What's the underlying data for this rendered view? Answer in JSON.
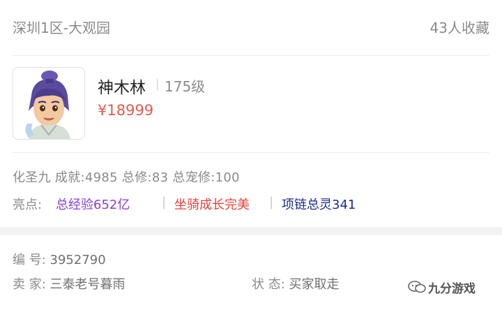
{
  "header": {
    "server": "深圳1区-大观园",
    "favorites": "43人收藏"
  },
  "role": {
    "name": "神木林",
    "level": "175级",
    "price": "¥18999"
  },
  "stats": "化圣九 成就:4985 总修:83 总宠修:100",
  "highlights": {
    "label": "亮点:",
    "items": [
      {
        "text": "总经验652亿",
        "color": "#8a3fd1"
      },
      {
        "text": "坐骑成长完美",
        "color": "#e0433a"
      },
      {
        "text": "项链总灵341",
        "color": "#1c2a8c"
      }
    ],
    "separator": "|"
  },
  "details": {
    "id_label": "编 号:",
    "id_value": "3952790",
    "seller_label": "卖 家:",
    "seller_value": "三泰老号暮雨",
    "status_label": "状 态:",
    "status_value": "买家取走"
  },
  "watermark": {
    "text": "九分游戏",
    "icon": "wechat-icon"
  }
}
